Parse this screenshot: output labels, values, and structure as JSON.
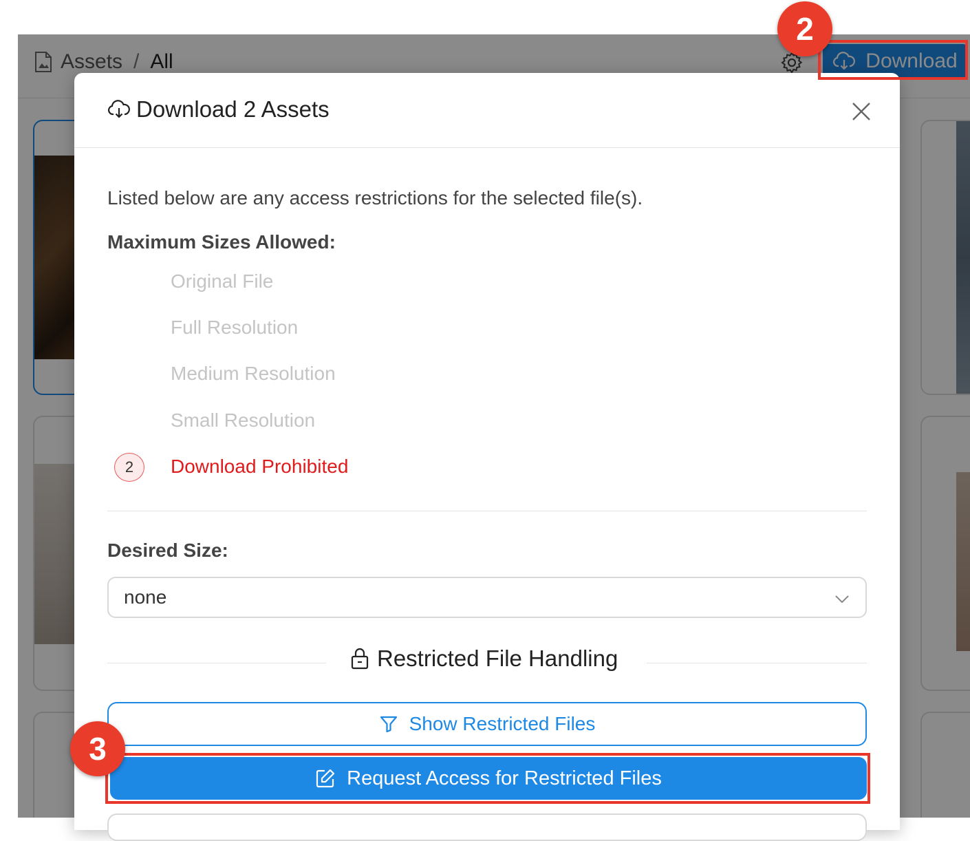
{
  "breadcrumb": {
    "root": "Assets",
    "separator": "/",
    "current": "All"
  },
  "toolbar": {
    "download_label": "Download"
  },
  "modal": {
    "title": "Download 2 Assets",
    "intro": "Listed below are any access restrictions for the selected file(s).",
    "max_sizes_heading": "Maximum Sizes Allowed:",
    "size_options": [
      "Original File",
      "Full Resolution",
      "Medium Resolution",
      "Small Resolution",
      "Download Prohibited"
    ],
    "prohibited_count": "2",
    "desired_size_heading": "Desired Size:",
    "desired_size_value": "none",
    "restricted_heading": "Restricted File Handling",
    "show_restricted_label": "Show Restricted Files",
    "request_access_label": "Request Access for Restricted Files"
  },
  "annotations": {
    "step_download": "2",
    "step_request": "3"
  },
  "colors": {
    "accent": "#1e88e5",
    "danger": "#e01b1b",
    "callout": "#e8362a"
  }
}
